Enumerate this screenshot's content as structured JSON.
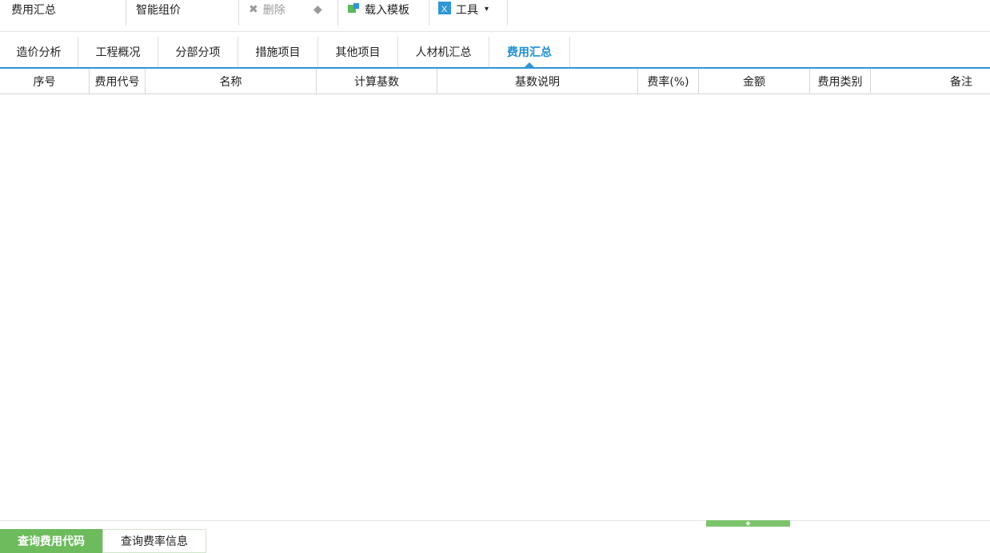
{
  "toolbar": {
    "items": [
      {
        "label": "费用汇总"
      },
      {
        "label": "智能组价"
      },
      {
        "label": "删除"
      },
      {
        "label": "载入模板"
      },
      {
        "label": "工具"
      }
    ]
  },
  "tabs": [
    {
      "label": "造价分析"
    },
    {
      "label": "工程概况"
    },
    {
      "label": "分部分项"
    },
    {
      "label": "措施项目"
    },
    {
      "label": "其他项目"
    },
    {
      "label": "人材机汇总"
    },
    {
      "label": "费用汇总"
    }
  ],
  "active_tab": "费用汇总",
  "table": {
    "columns": [
      "序号",
      "费用代号",
      "名称",
      "计算基数",
      "基数说明",
      "费率(%)",
      "金额",
      "费用类别",
      "备注"
    ],
    "rows": []
  },
  "bottom_tabs": [
    {
      "label": "查询费用代码"
    },
    {
      "label": "查询费率信息"
    }
  ],
  "colors": {
    "accent_blue": "#2f97d6",
    "active_tab_text": "#1f8fd6",
    "green": "#6dbb5d"
  }
}
